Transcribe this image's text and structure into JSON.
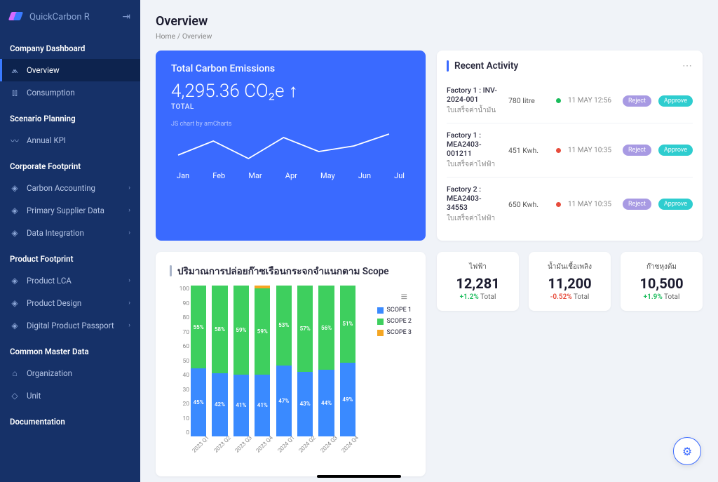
{
  "brand": "QuickCarbon R",
  "page": {
    "title": "Overview",
    "bc_home": "Home",
    "bc_sep": "/",
    "bc_cur": "Overview"
  },
  "nav": {
    "s0": "Company Dashboard",
    "overview": "Overview",
    "consumption": "Consumption",
    "s1": "Scenario Planning",
    "kpi": "Annual KPI",
    "s2": "Corporate Footprint",
    "ca": "Carbon Accounting",
    "psd": "Primary Supplier Data",
    "di": "Data Integration",
    "s3": "Product Footprint",
    "lca": "Product LCA",
    "pd": "Product Design",
    "dpp": "Digital Product Passport",
    "s4": "Common Master Data",
    "org": "Organization",
    "unit": "Unit",
    "s5": "Documentation"
  },
  "emissions": {
    "title": "Total Carbon Emissions",
    "value": "4,295.36 CO₂e ↑",
    "sub": "TOTAL",
    "note": "JS chart by amCharts",
    "months": [
      "Jan",
      "Feb",
      "Mar",
      "Apr",
      "May",
      "Jun",
      "Jul"
    ]
  },
  "activity": {
    "title": "Recent Activity",
    "rows": [
      {
        "l1": "Factory 1 : INV-2024-001",
        "l2": "ใบเสร็จค่าน้ำมัน",
        "amt": "780 litre",
        "status": "g",
        "date": "11 MAY 12:56"
      },
      {
        "l1": "Factory 1 : MEA2403-001211",
        "l2": "ใบเสร็จค่าไฟฟ้า",
        "amt": "451 Kwh.",
        "status": "r",
        "date": "11 MAY 10:35"
      },
      {
        "l1": "Factory 2 : MEA2403-34553",
        "l2": "ใบเสร็จค่าไฟฟ้า",
        "amt": "650 Kwh.",
        "status": "r",
        "date": "11 MAY 10:35"
      }
    ],
    "reject": "Reject",
    "approve": "Approve"
  },
  "scope": {
    "title": "ปริมาณการปล่อยก๊าซเรือนกระจกจำแนกตาม Scope",
    "legend": {
      "s1": "SCOPE 1",
      "s2": "SCOPE 2",
      "s3": "SCOPE 3"
    }
  },
  "stats": [
    {
      "label": "ไฟฟ้า",
      "value": "12,281",
      "delta": "+1.2%",
      "dir": "up",
      "tail": " Total"
    },
    {
      "label": "น้ำมันเชื้อเพลิง",
      "value": "11,200",
      "delta": "-0.52%",
      "dir": "dn",
      "tail": " Total"
    },
    {
      "label": "ก๊าซหุงต้ม",
      "value": "10,500",
      "delta": "+1.9%",
      "dir": "up",
      "tail": " Total"
    }
  ],
  "chart_data": [
    {
      "type": "line",
      "title": "Total Carbon Emissions",
      "categories": [
        "Jan",
        "Feb",
        "Mar",
        "Apr",
        "May",
        "Jun",
        "Jul"
      ],
      "values": [
        4100,
        4400,
        4050,
        4500,
        4200,
        4300,
        4600
      ],
      "note": "trend sparkline, values approximate"
    },
    {
      "type": "bar",
      "stacked": true,
      "title": "ปริมาณการปล่อยก๊าซเรือนกระจกจำแนกตาม Scope",
      "categories": [
        "2023 Q1",
        "2023 Q2",
        "2023 Q3",
        "2023 Q4",
        "2024 Q1",
        "2024 Q2",
        "2024 Q3",
        "2024 Q4"
      ],
      "ylim": [
        0,
        100
      ],
      "ylabel": "",
      "series": [
        {
          "name": "SCOPE 1",
          "values": [
            45,
            42,
            41,
            41,
            47,
            43,
            44,
            49
          ],
          "color": "#3a8aff"
        },
        {
          "name": "SCOPE 2",
          "values": [
            55,
            58,
            59,
            59,
            53,
            57,
            56,
            51
          ],
          "color": "#3ecf5e"
        },
        {
          "name": "SCOPE 3",
          "values": [
            0,
            0,
            0,
            0,
            0,
            0,
            0,
            0
          ],
          "color": "#f5a623",
          "note": "tiny sliver at top of 2023 Q4"
        }
      ]
    }
  ]
}
